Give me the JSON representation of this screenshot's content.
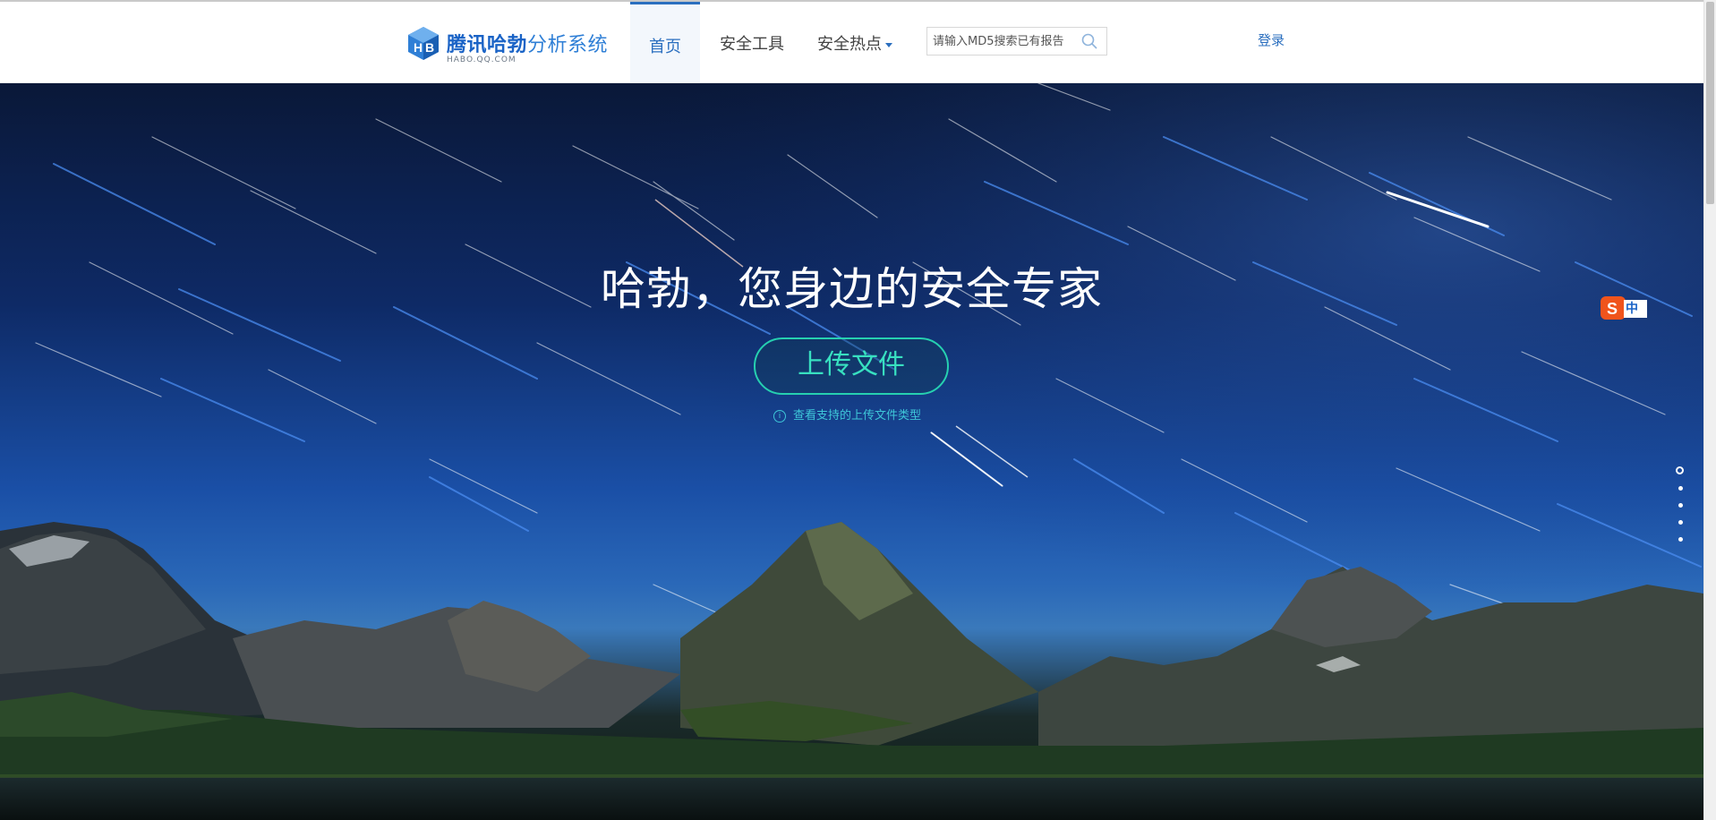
{
  "header": {
    "logo_title_bold": "腾讯哈勃",
    "logo_title_thin": "分析系统",
    "logo_subtitle": "HABO.QQ.COM",
    "nav": [
      {
        "label": "首页",
        "active": true
      },
      {
        "label": "安全工具",
        "active": false
      },
      {
        "label": "安全热点",
        "active": false,
        "has_dropdown": true
      }
    ],
    "search": {
      "placeholder": "请输入MD5搜索已有报告",
      "value": ""
    },
    "login_label": "登录"
  },
  "hero": {
    "headline": "哈勃，您身边的安全专家",
    "upload_button": "上传文件",
    "supported_types_link": "查看支持的上传文件类型",
    "ime_label": "中"
  },
  "pager": {
    "count": 5,
    "active_index": 0
  },
  "colors": {
    "brand_blue": "#2b6fbf",
    "accent_teal": "#26d0b0",
    "link_cyan": "#3ec6d8"
  },
  "icons": [
    "habo-logo-icon",
    "search-icon",
    "info-icon",
    "sogou-ime-icon",
    "dropdown-caret-icon"
  ]
}
